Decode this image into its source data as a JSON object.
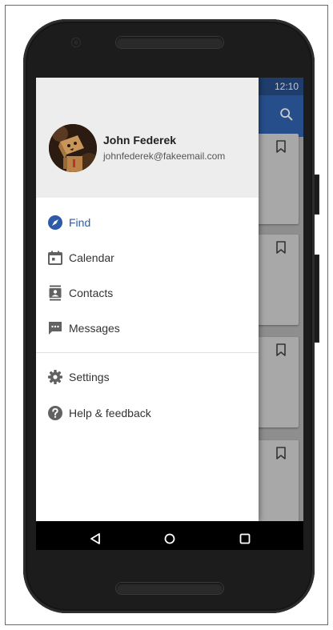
{
  "status_bar": {
    "time": "12:10"
  },
  "app_bar": {
    "search_icon": "search-icon"
  },
  "drawer": {
    "user": {
      "name": "John Federek",
      "email": "johnfederek@fakeemail.com"
    },
    "primary_items": [
      {
        "label": "Find",
        "icon": "compass-icon",
        "active": true
      },
      {
        "label": "Calendar",
        "icon": "calendar-icon",
        "active": false
      },
      {
        "label": "Contacts",
        "icon": "contacts-icon",
        "active": false
      },
      {
        "label": "Messages",
        "icon": "messages-icon",
        "active": false
      }
    ],
    "secondary_items": [
      {
        "label": "Settings",
        "icon": "gear-icon"
      },
      {
        "label": "Help & feedback",
        "icon": "help-icon"
      }
    ]
  },
  "nav_bar": {
    "back_icon": "back-icon",
    "home_icon": "home-icon",
    "recents_icon": "recents-icon"
  },
  "colors": {
    "accent": "#2d5ba8",
    "app_bar": "#264e8a",
    "drawer_header": "#ededed",
    "icon_grey": "#616161"
  }
}
